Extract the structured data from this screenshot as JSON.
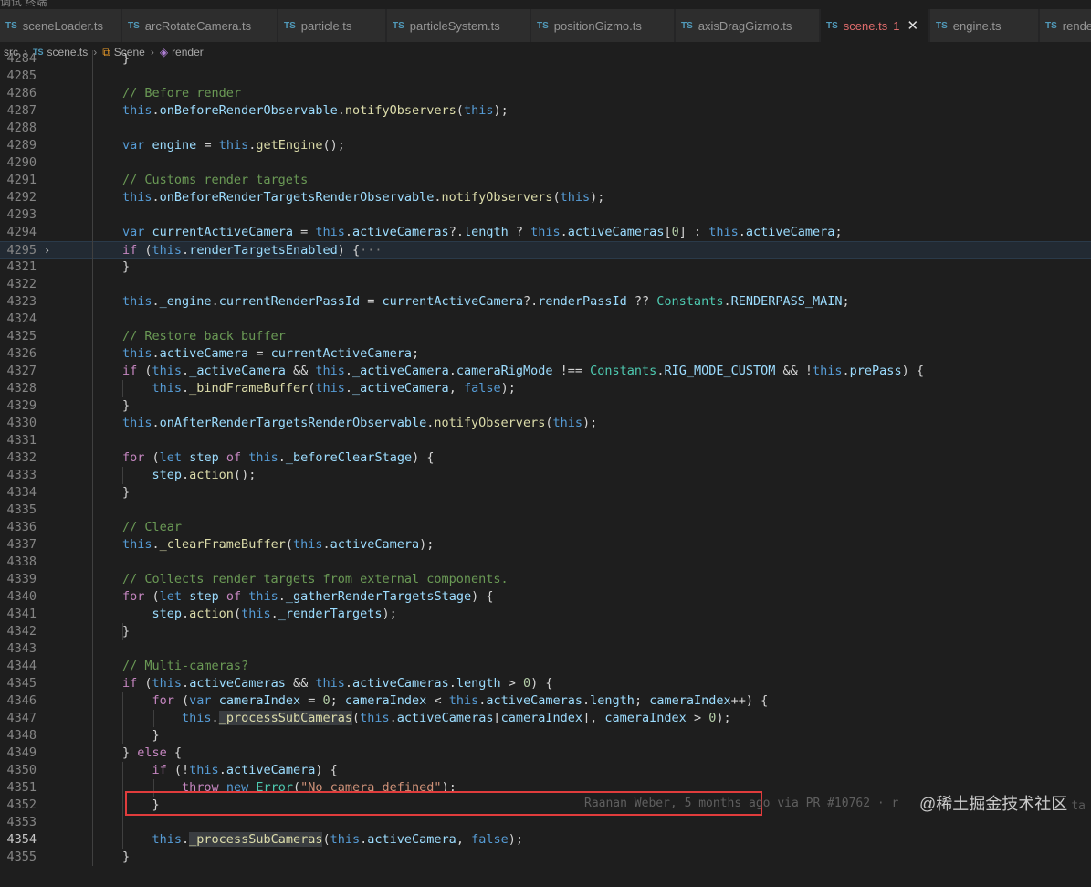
{
  "top_strip_text": "调试 终端",
  "tabs": [
    {
      "label": "sceneLoader.ts",
      "active": false
    },
    {
      "label": "arcRotateCamera.ts",
      "active": false
    },
    {
      "label": "particle.ts",
      "active": false
    },
    {
      "label": "particleSystem.ts",
      "active": false
    },
    {
      "label": "positionGizmo.ts",
      "active": false
    },
    {
      "label": "axisDragGizmo.ts",
      "active": false
    },
    {
      "label": "scene.ts",
      "active": true,
      "badge": "1"
    },
    {
      "label": "engine.ts",
      "active": false
    },
    {
      "label": "rende",
      "active": false
    }
  ],
  "tab_lang": "TS",
  "breadcrumb": {
    "folder": "src",
    "file": "scene.ts",
    "class": "Scene",
    "method": "render"
  },
  "lines": [
    {
      "n": "4284",
      "code": "}"
    },
    {
      "n": "4285",
      "code": ""
    },
    {
      "n": "4286",
      "code": "// Before render"
    },
    {
      "n": "4287",
      "code": "this.onBeforeRenderObservable.notifyObservers(this);"
    },
    {
      "n": "4288",
      "code": ""
    },
    {
      "n": "4289",
      "code": "var engine = this.getEngine();"
    },
    {
      "n": "4290",
      "code": ""
    },
    {
      "n": "4291",
      "code": "// Customs render targets"
    },
    {
      "n": "4292",
      "code": "this.onBeforeRenderTargetsRenderObservable.notifyObservers(this);"
    },
    {
      "n": "4293",
      "code": ""
    },
    {
      "n": "4294",
      "code": "var currentActiveCamera = this.activeCameras?.length ? this.activeCameras[0] : this.activeCamera;"
    },
    {
      "n": "4295",
      "code": "if (this.renderTargetsEnabled) {···"
    },
    {
      "n": "4321",
      "code": "}"
    },
    {
      "n": "4322",
      "code": ""
    },
    {
      "n": "4323",
      "code": "this._engine.currentRenderPassId = currentActiveCamera?.renderPassId ?? Constants.RENDERPASS_MAIN;"
    },
    {
      "n": "4324",
      "code": ""
    },
    {
      "n": "4325",
      "code": "// Restore back buffer"
    },
    {
      "n": "4326",
      "code": "this.activeCamera = currentActiveCamera;"
    },
    {
      "n": "4327",
      "code": "if (this._activeCamera && this._activeCamera.cameraRigMode !== Constants.RIG_MODE_CUSTOM && !this.prePass) {"
    },
    {
      "n": "4328",
      "code": "    this._bindFrameBuffer(this._activeCamera, false);"
    },
    {
      "n": "4329",
      "code": "}"
    },
    {
      "n": "4330",
      "code": "this.onAfterRenderTargetsRenderObservable.notifyObservers(this);"
    },
    {
      "n": "4331",
      "code": ""
    },
    {
      "n": "4332",
      "code": "for (let step of this._beforeClearStage) {"
    },
    {
      "n": "4333",
      "code": "    step.action();"
    },
    {
      "n": "4334",
      "code": "}"
    },
    {
      "n": "4335",
      "code": ""
    },
    {
      "n": "4336",
      "code": "// Clear"
    },
    {
      "n": "4337",
      "code": "this._clearFrameBuffer(this.activeCamera);"
    },
    {
      "n": "4338",
      "code": ""
    },
    {
      "n": "4339",
      "code": "// Collects render targets from external components."
    },
    {
      "n": "4340",
      "code": "for (let step of this._gatherRenderTargetsStage) {"
    },
    {
      "n": "4341",
      "code": "    step.action(this._renderTargets);"
    },
    {
      "n": "4342",
      "code": "}"
    },
    {
      "n": "4343",
      "code": ""
    },
    {
      "n": "4344",
      "code": "// Multi-cameras?"
    },
    {
      "n": "4345",
      "code": "if (this.activeCameras && this.activeCameras.length > 0) {"
    },
    {
      "n": "4346",
      "code": "    for (var cameraIndex = 0; cameraIndex < this.activeCameras.length; cameraIndex++) {"
    },
    {
      "n": "4347",
      "code": "        this._processSubCameras(this.activeCameras[cameraIndex], cameraIndex > 0);"
    },
    {
      "n": "4348",
      "code": "    }"
    },
    {
      "n": "4349",
      "code": "} else {"
    },
    {
      "n": "4350",
      "code": "    if (!this.activeCamera) {"
    },
    {
      "n": "4351",
      "code": "        throw new Error(\"No camera defined\");"
    },
    {
      "n": "4352",
      "code": "    }"
    },
    {
      "n": "4353",
      "code": ""
    },
    {
      "n": "4354",
      "code": "    this._processSubCameras(this.activeCamera, false);"
    },
    {
      "n": "4355",
      "code": "}"
    }
  ],
  "blame": "Raanan Weber, 5 months ago via PR #10762",
  "blame_tail": "· r",
  "blame_tail2": "ta",
  "watermark": "@稀土掘金技术社区",
  "colors": {
    "keyword": "#569cd6",
    "control": "#c586c0",
    "comment": "#6a9955",
    "string": "#ce9178",
    "type": "#4ec9b0",
    "variable": "#9cdcfe",
    "function": "#dcdcaa",
    "annotation_box": "#e03c3c"
  }
}
